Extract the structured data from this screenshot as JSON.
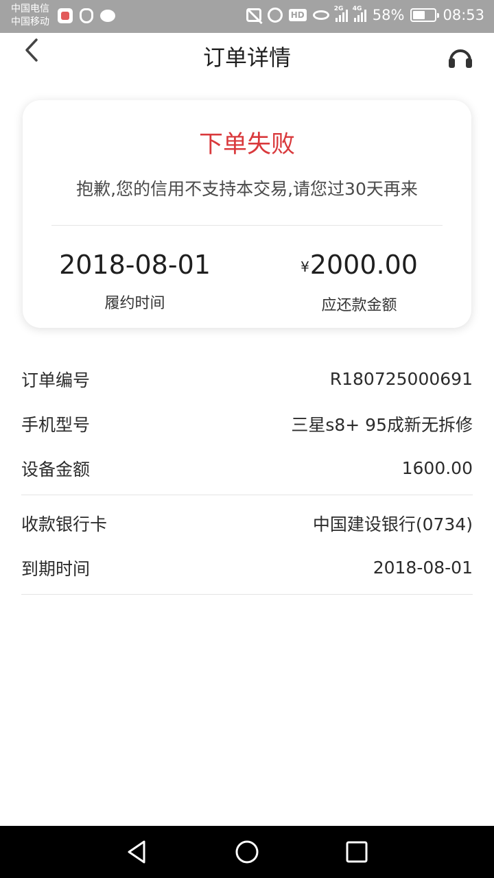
{
  "status_bar": {
    "carrier_1": "中国电信",
    "carrier_2": "中国移动",
    "network_1": "2G",
    "network_2": "4G",
    "hd_label": "HD",
    "battery": "58%",
    "battery_level": 0.58,
    "time": "08:53",
    "icons": [
      "app-badge-icon",
      "owl-icon",
      "chat-icon",
      "mute-icon",
      "alarm-icon",
      "hd-icon",
      "eye-icon",
      "signal-icon",
      "battery-icon"
    ]
  },
  "header": {
    "title": "订单详情",
    "back_icon": "chevron-left-icon",
    "support_icon": "headset-icon"
  },
  "result_card": {
    "title": "下单失败",
    "message": "抱歉,您的信用不支持本交易,请您过30天再来",
    "title_color": "#d9393c",
    "left_value": "2018-08-01",
    "left_label": "履约时间",
    "currency_symbol": "¥",
    "right_value": "2000.00",
    "right_label": "应还款金额"
  },
  "details": {
    "group1": [
      {
        "label": "订单编号",
        "value": "R180725000691"
      },
      {
        "label": "手机型号",
        "value": "三星s8+ 95成新无拆修"
      },
      {
        "label": "设备金额",
        "value": "1600.00"
      }
    ],
    "group2": [
      {
        "label": "收款银行卡",
        "value": "中国建设银行(0734)"
      },
      {
        "label": "到期时间",
        "value": "2018-08-01"
      }
    ]
  },
  "nav_bar": {
    "icons": [
      "triangle-back-icon",
      "circle-home-icon",
      "square-recents-icon"
    ]
  }
}
